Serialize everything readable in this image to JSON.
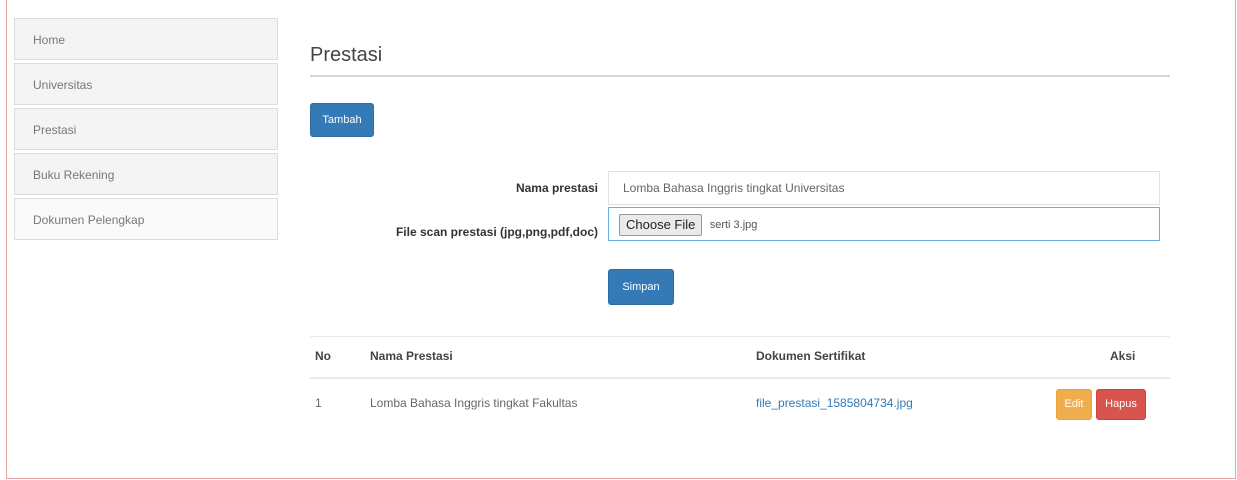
{
  "sidebar": {
    "items": [
      {
        "label": "Home"
      },
      {
        "label": "Universitas"
      },
      {
        "label": "Prestasi"
      },
      {
        "label": "Buku Rekening"
      },
      {
        "label": "Dokumen Pelengkap"
      }
    ]
  },
  "main": {
    "title": "Prestasi",
    "add_button": "Tambah",
    "form": {
      "name_label": "Nama prestasi",
      "name_value": "Lomba Bahasa Inggris tingkat Universitas",
      "file_label": "File scan prestasi (jpg,png,pdf,doc)",
      "choose_file_label": "Choose File",
      "file_name": "serti 3.jpg",
      "save_button": "Simpan"
    },
    "table": {
      "headers": [
        "No",
        "Nama Prestasi",
        "Dokumen Sertifikat",
        "Aksi"
      ],
      "rows": [
        {
          "no": "1",
          "name": "Lomba Bahasa Inggris tingkat Fakultas",
          "document": "file_prestasi_1585804734.jpg",
          "edit": "Edit",
          "delete": "Hapus"
        }
      ]
    }
  },
  "colors": {
    "primary": "#337ab7",
    "warning": "#f0ad4e",
    "danger": "#d9534f",
    "frame_border": "#e3a3a3"
  }
}
